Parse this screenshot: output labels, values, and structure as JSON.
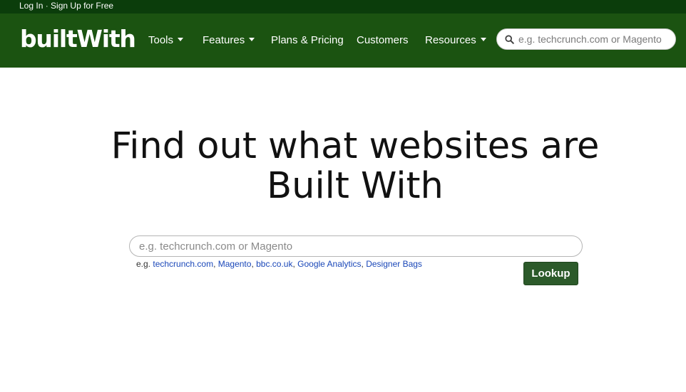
{
  "topbar": {
    "login": "Log In",
    "separator": " · ",
    "signup": "Sign Up for Free"
  },
  "nav": {
    "logo": "builtWith",
    "items": [
      {
        "label": "Tools",
        "dropdown": true
      },
      {
        "label": "Features",
        "dropdown": true
      },
      {
        "label": "Plans & Pricing",
        "dropdown": false
      },
      {
        "label": "Customers",
        "dropdown": false
      },
      {
        "label": "Resources",
        "dropdown": true
      }
    ],
    "search_placeholder": "e.g. techcrunch.com or Magento",
    "search_icon": "search-icon"
  },
  "hero": {
    "line1": "Find out what websites are",
    "line2": "Built With"
  },
  "search": {
    "placeholder": "e.g. techcrunch.com or Magento",
    "examples_prefix": "e.g. ",
    "examples": [
      "techcrunch.com",
      "Magento",
      "bbc.co.uk",
      "Google Analytics",
      "Designer Bags"
    ],
    "button_label": "Lookup"
  },
  "colors": {
    "topbar_bg": "#0b3d0b",
    "navbar_bg": "#1b5311",
    "button_bg": "#2c5a2a",
    "link": "#1a47b8"
  }
}
